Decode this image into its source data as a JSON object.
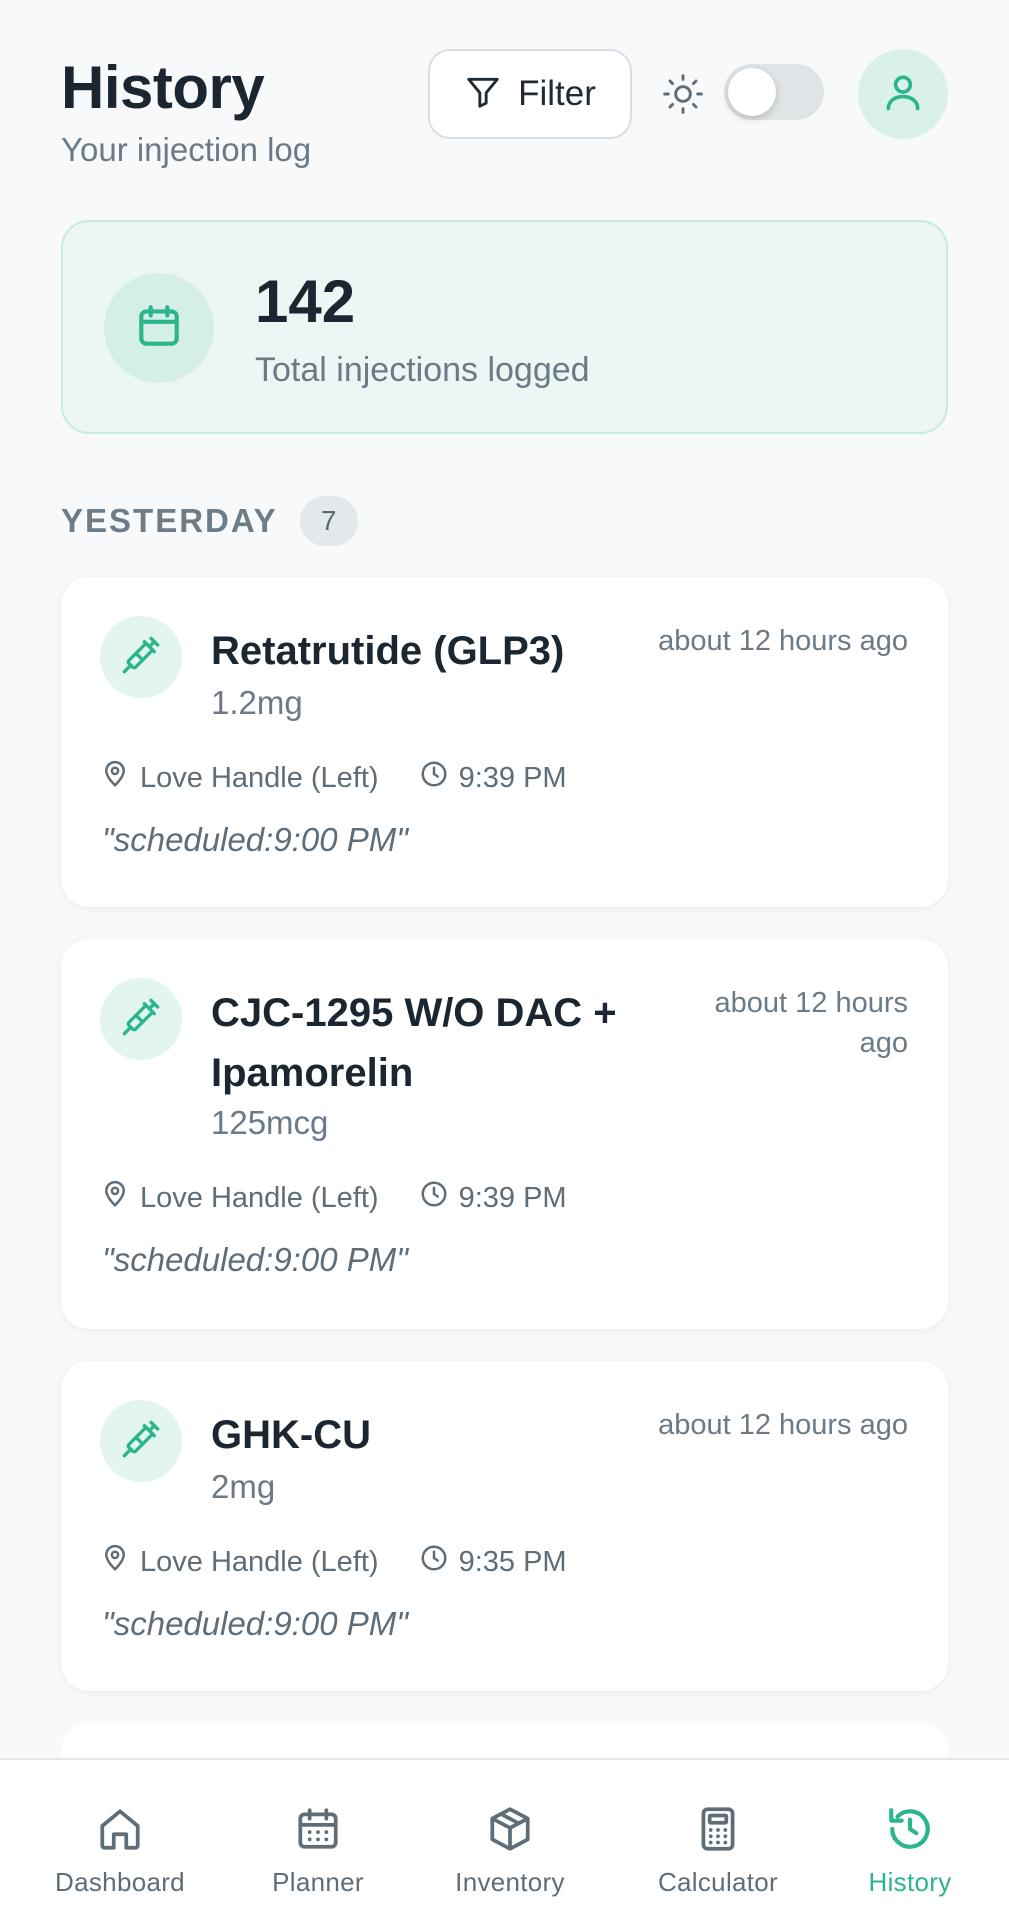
{
  "header": {
    "title": "History",
    "subtitle": "Your injection log",
    "filter_label": "Filter",
    "theme_toggle_state": "off"
  },
  "summary": {
    "count": "142",
    "label": "Total injections logged"
  },
  "section": {
    "title": "YESTERDAY",
    "badge": "7"
  },
  "entries": [
    {
      "name": "Retatrutide (GLP3)",
      "dose": "1.2mg",
      "ago": "about 12 hours ago",
      "site": "Love Handle (Left)",
      "time": "9:39 PM",
      "note": "\"scheduled:9:00 PM\""
    },
    {
      "name_line1": "CJC-1295 W/O DAC +",
      "name_line2": "Ipamorelin",
      "dose": "125mcg",
      "ago_line1": "about 12 hours",
      "ago_line2": "ago",
      "site": "Love Handle (Left)",
      "time": "9:39 PM",
      "note": "\"scheduled:9:00 PM\""
    },
    {
      "name": "GHK-CU",
      "dose": "2mg",
      "ago": "about 12 hours ago",
      "site": "Love Handle (Left)",
      "time": "9:35 PM",
      "note": "\"scheduled:9:00 PM\""
    }
  ],
  "nav": {
    "items": [
      {
        "label": "Dashboard",
        "icon": "home-icon"
      },
      {
        "label": "Planner",
        "icon": "calendar-icon"
      },
      {
        "label": "Inventory",
        "icon": "box-icon"
      },
      {
        "label": "Calculator",
        "icon": "calculator-icon"
      },
      {
        "label": "History",
        "icon": "history-icon"
      }
    ],
    "active": "History"
  },
  "colors": {
    "accent": "#2bb58c",
    "accent_soft": "#e2f5ef",
    "summary_bg": "#ecf6f4",
    "text_primary": "#1b2630",
    "text_muted": "#6b7a86"
  }
}
